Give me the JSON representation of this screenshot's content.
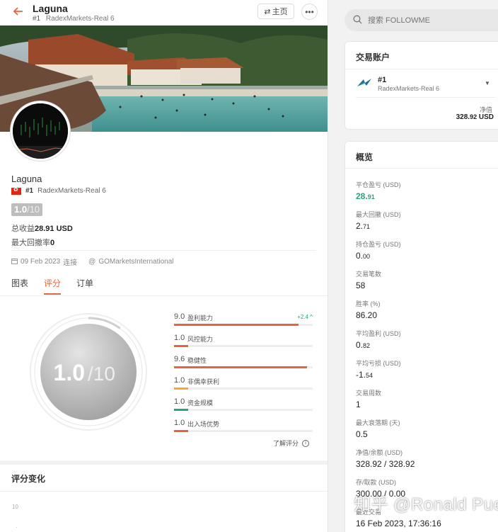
{
  "header": {
    "title": "Laguna",
    "rank": "#1",
    "broker": "RadexMarkets-Real 6",
    "home_button": "主页",
    "more_button": "•••"
  },
  "profile": {
    "name": "Laguna",
    "rank": "#1",
    "broker": "RadexMarkets-Real 6",
    "score": "1.0",
    "score_denominator": "/10",
    "total_profit_label": "总收益",
    "total_profit_value": "28.91",
    "total_profit_unit": "USD",
    "max_drawdown_label": "最大回撤率",
    "max_drawdown_value": "0",
    "date": "09 Feb 2023",
    "connect_label": "连接",
    "source": "GOMarketsInternational"
  },
  "tabs": [
    {
      "label": "图表",
      "active": false
    },
    {
      "label": "评分",
      "active": true
    },
    {
      "label": "订单",
      "active": false
    }
  ],
  "gauge": {
    "score": "1.0",
    "denominator": "/10",
    "fraction": 0.1
  },
  "metrics": [
    {
      "value": "9.0",
      "label": "盈利能力",
      "change": "+2.4",
      "fraction": 0.9,
      "color": "#e8643c"
    },
    {
      "value": "1.0",
      "label": "风控能力",
      "change": "",
      "fraction": 0.1,
      "color": "#e8643c"
    },
    {
      "value": "9.6",
      "label": "稳健性",
      "change": "",
      "fraction": 0.96,
      "color": "#e8643c"
    },
    {
      "value": "1.0",
      "label": "非偶幸获利",
      "change": "",
      "fraction": 0.1,
      "color": "#f2a93b"
    },
    {
      "value": "1.0",
      "label": "资金规模",
      "change": "",
      "fraction": 0.1,
      "color": "#27a57a"
    },
    {
      "value": "1.0",
      "label": "出入场优势",
      "change": "",
      "fraction": 0.1,
      "color": "#e8643c"
    }
  ],
  "learn_score": "了解评分",
  "score_change": {
    "title": "评分变化",
    "axis_top": "10"
  },
  "search": {
    "placeholder": "搜索 FOLLOWME"
  },
  "account_card": {
    "title": "交易账户",
    "rank": "#1",
    "broker": "RadexMarkets-Real 6",
    "nav_label": "净值",
    "nav_value_int": "328.",
    "nav_value_dec": "92",
    "nav_unit": "USD"
  },
  "overview": {
    "title": "概览",
    "items": [
      {
        "label": "平仓盈亏 (USD)",
        "int": "28.",
        "dec": "91",
        "green": true
      },
      {
        "label": "最大回撤 (USD)",
        "int": "2.",
        "dec": "71",
        "green": false
      },
      {
        "label": "持仓盈亏 (USD)",
        "int": "0.",
        "dec": "00",
        "green": false
      },
      {
        "label": "交易笔数",
        "int": "58",
        "dec": "",
        "green": false
      },
      {
        "label": "胜率 (%)",
        "int": "86.20",
        "dec": "",
        "green": false
      },
      {
        "label": "平均盈利 (USD)",
        "int": "0.",
        "dec": "82",
        "green": false
      },
      {
        "label": "平均亏损 (USD)",
        "int": "-1.",
        "dec": "54",
        "green": false
      },
      {
        "label": "交易周数",
        "int": "1",
        "dec": "",
        "green": false
      },
      {
        "label": "最大衰落期 (天)",
        "int": "0.5",
        "dec": "",
        "green": false
      },
      {
        "label": "净值/余额 (USD)",
        "int": "328.92 / 328.92",
        "dec": "",
        "green": false
      },
      {
        "label": "存/取款 (USD)",
        "int": "300.00 / 0.00",
        "dec": "",
        "green": false
      },
      {
        "label": "最近交易",
        "int": "16 Feb 2023, 17:36:16",
        "dec": "",
        "green": false
      }
    ]
  },
  "watermark": "知乎 @Ronald Puen",
  "colors": {
    "accent": "#e8643c",
    "green": "#27a57a"
  }
}
